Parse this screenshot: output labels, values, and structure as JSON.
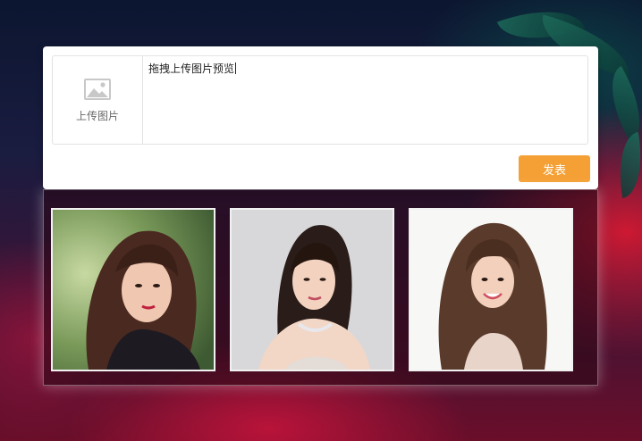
{
  "composer": {
    "upload_label": "上传图片",
    "text_value": "拖拽上传图片预览",
    "publish_label": "发表"
  },
  "gallery": {
    "items": [
      {
        "icon": "portrait-photo-1"
      },
      {
        "icon": "portrait-photo-2"
      },
      {
        "icon": "portrait-photo-3"
      }
    ]
  },
  "colors": {
    "publish_button": "#f5a035",
    "card_background": "#ffffff",
    "border": "#e2e2e2"
  }
}
